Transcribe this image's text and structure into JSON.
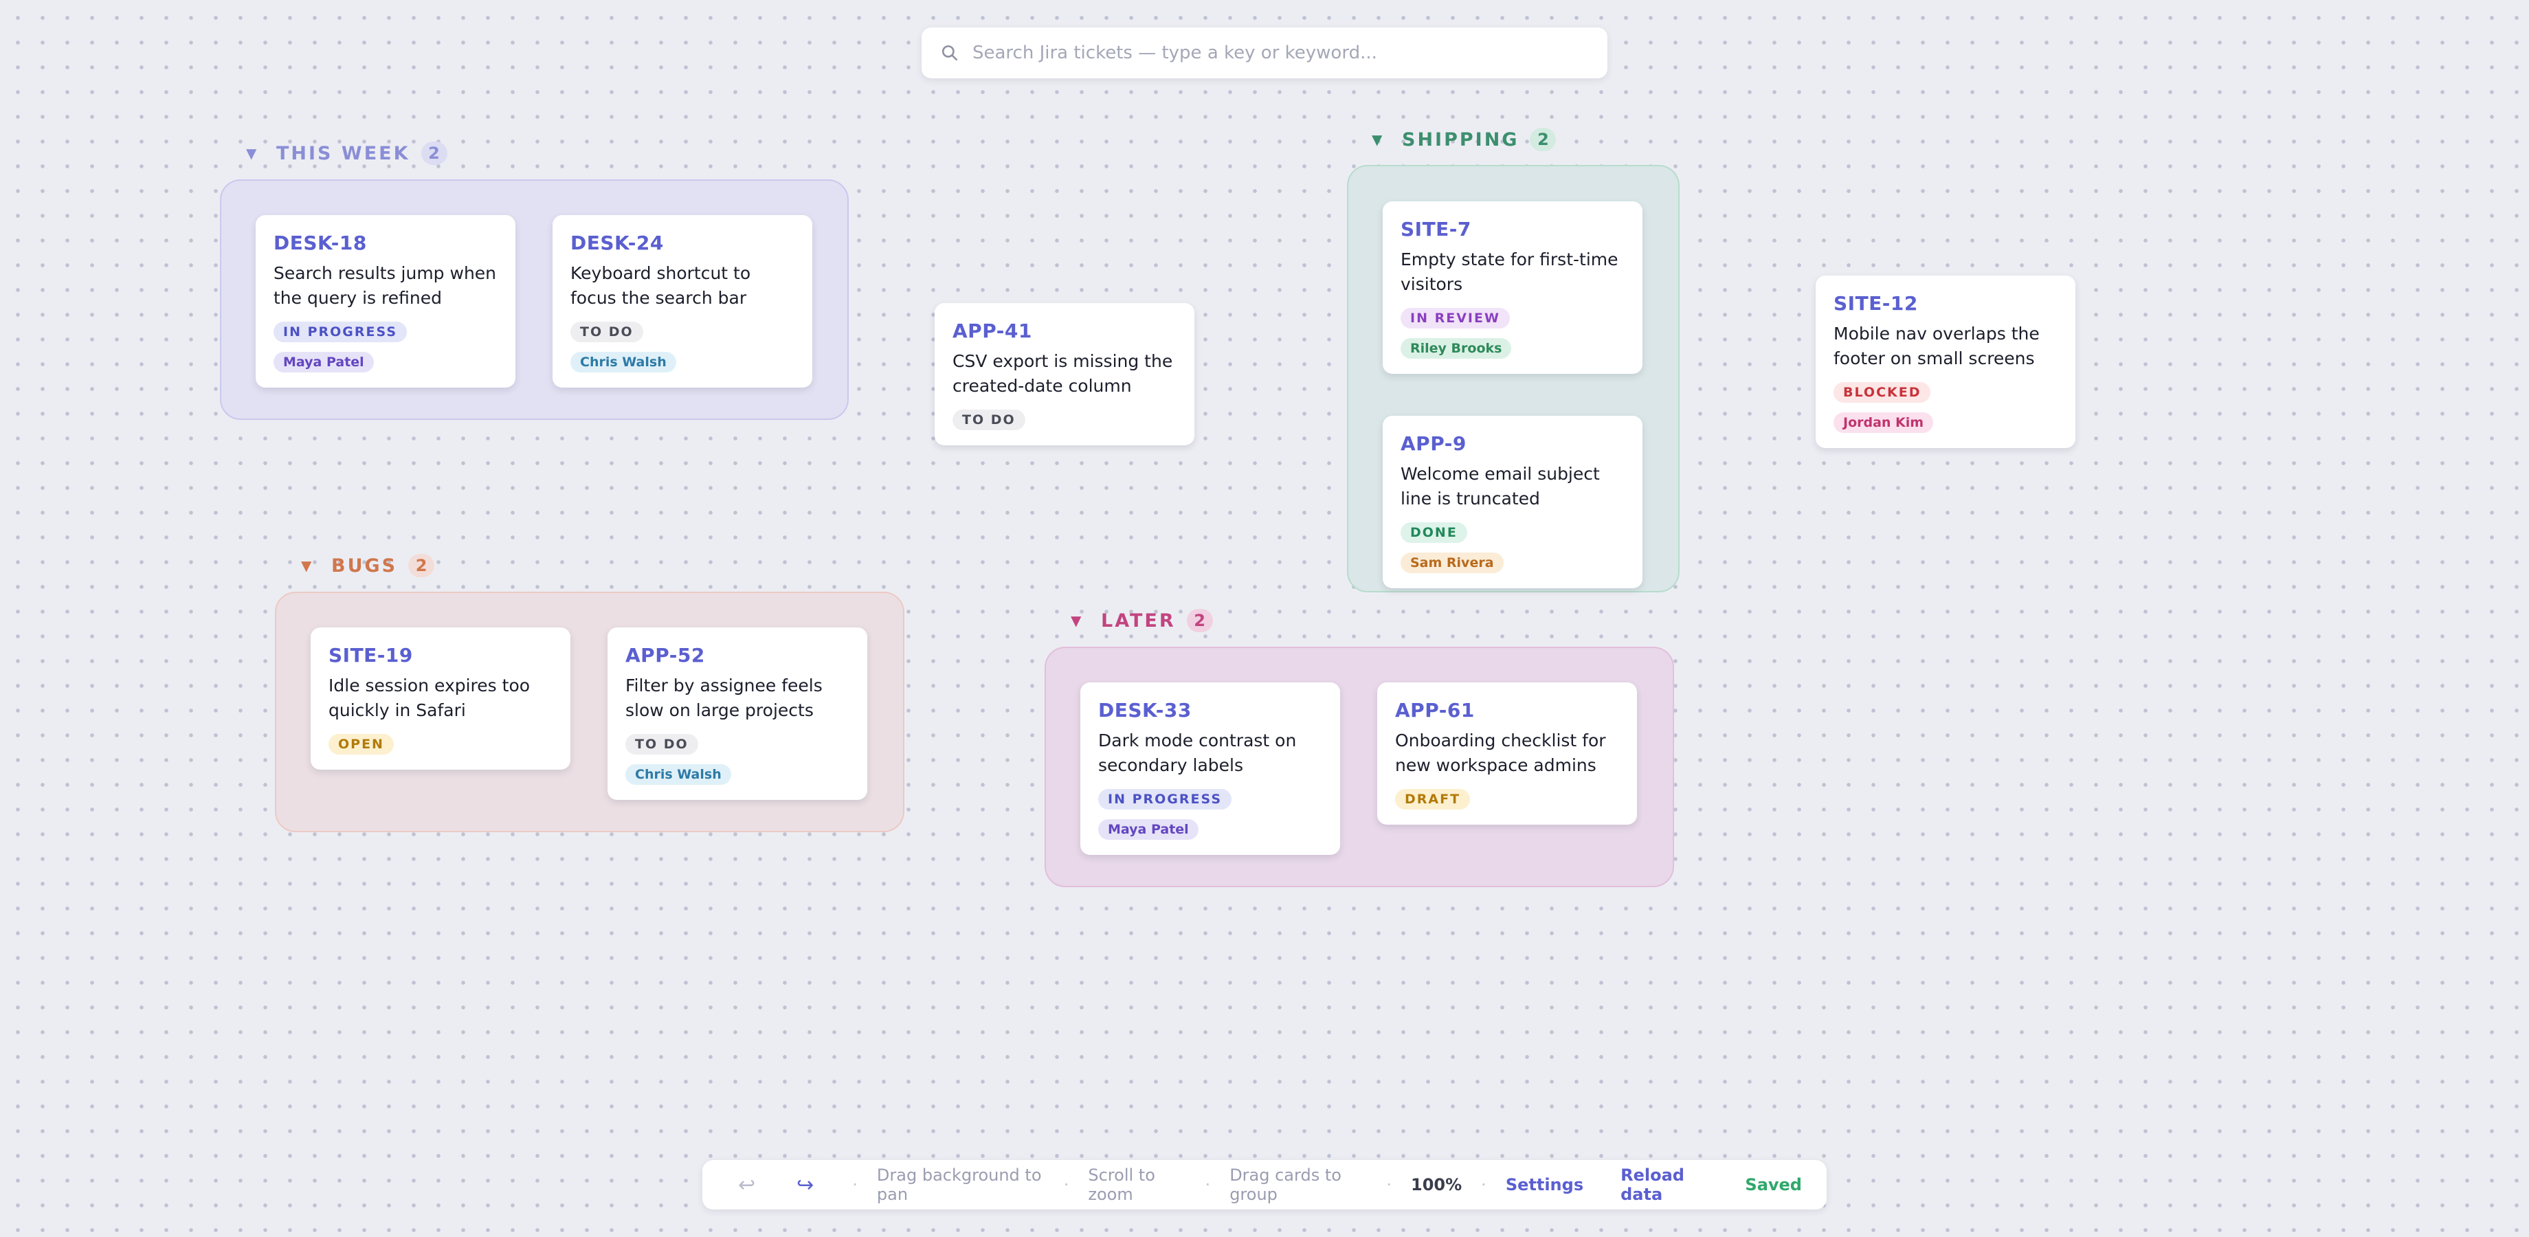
{
  "search": {
    "placeholder": "Search Jira tickets — type a key or keyword..."
  },
  "groups": [
    {
      "name": "THIS WEEK",
      "count": "2",
      "caret": "▼"
    },
    {
      "name": "SHIPPING",
      "count": "2",
      "caret": "▼"
    },
    {
      "name": "BUGS",
      "count": "2",
      "caret": "▼"
    },
    {
      "name": "LATER",
      "count": "2",
      "caret": "▼"
    }
  ],
  "cards": [
    {
      "key": "DESK-18",
      "title": "Search results jump when the query is refined",
      "status": "IN PROGRESS",
      "assignee": "Maya Patel"
    },
    {
      "key": "DESK-24",
      "title": "Keyboard shortcut to focus the search bar",
      "status": "TO DO",
      "assignee": "Chris Walsh"
    },
    {
      "key": "APP-41",
      "title": "CSV export is missing the created-date column",
      "status": "TO DO"
    },
    {
      "key": "SITE-7",
      "title": "Empty state for first-time visitors",
      "status": "IN REVIEW",
      "assignee": "Riley Brooks"
    },
    {
      "key": "APP-9",
      "title": "Welcome email subject line is truncated",
      "status": "DONE",
      "assignee": "Sam Rivera"
    },
    {
      "key": "SITE-12",
      "title": "Mobile nav overlaps the footer on small screens",
      "status": "BLOCKED",
      "assignee": "Jordan Kim"
    },
    {
      "key": "SITE-19",
      "title": "Idle session expires too quickly in Safari",
      "status": "OPEN"
    },
    {
      "key": "APP-52",
      "title": "Filter by assignee feels slow on large projects",
      "status": "TO DO",
      "assignee": "Chris Walsh"
    },
    {
      "key": "DESK-33",
      "title": "Dark mode contrast on secondary labels",
      "status": "IN PROGRESS",
      "assignee": "Maya Patel"
    },
    {
      "key": "APP-61",
      "title": "Onboarding checklist for new workspace admins",
      "status": "DRAFT"
    }
  ],
  "toolbar": {
    "undo_icon": "undo-icon",
    "redo_icon": "redo-icon",
    "undo_glyph": "↩",
    "redo_glyph": "↪",
    "separator": "·",
    "hint_pan": "Drag background to pan",
    "hint_zoom": "Scroll to zoom",
    "hint_group": "Drag cards to group",
    "zoom": "100%",
    "settings": "Settings",
    "reload": "Reload data",
    "saved": "Saved"
  },
  "colors": {
    "key": "#5a5fd0",
    "group_this_week": "#8a8ed6",
    "group_shipping": "#3c8f6e",
    "group_bugs": "#d0774d",
    "group_later": "#c2447f"
  }
}
